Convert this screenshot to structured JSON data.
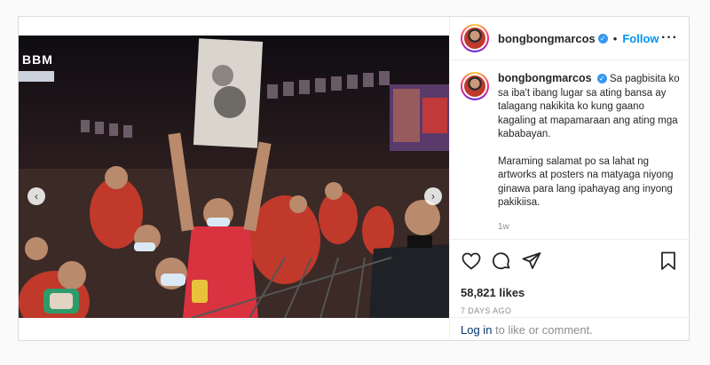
{
  "post": {
    "username": "bongbongmarcos",
    "follow_label": "Follow",
    "separator": "•",
    "more_icon": "more-options-icon",
    "verified_icon": "verified-badge-icon",
    "caption": {
      "username": "bongbongmarcos",
      "paragraph1": "Sa pagbisita ko sa iba't ibang lugar sa ating bansa ay talagang nakikita ko kung gaano kagaling at mapamaraan ang ating mga kababayan.",
      "paragraph2": "Maraming salamat po sa lahat ng artworks at posters na matyaga niyong ginawa para lang ipahayag ang inyong pakikiisa.",
      "relative_time": "1w"
    },
    "likes": "58,821 likes",
    "date": "7 DAYS AGO",
    "login_link": "Log in",
    "login_text": " to like or comment.",
    "media": {
      "logo_text": "BBM",
      "prev_icon": "chevron-left-icon",
      "next_icon": "chevron-right-icon",
      "slide_count": 10,
      "active_slide": 1
    },
    "colors": {
      "accent": "#0095f6",
      "verified": "#3897f0",
      "muted": "#8e8e8e"
    }
  }
}
